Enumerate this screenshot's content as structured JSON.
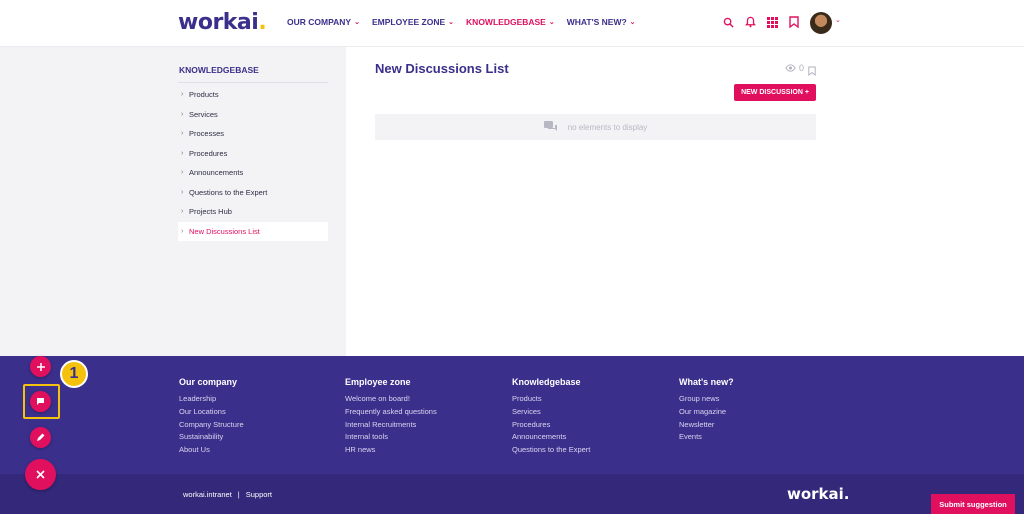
{
  "header": {
    "logo": "workai",
    "logo_dot": ".",
    "nav": [
      {
        "label": "OUR COMPANY",
        "active": false
      },
      {
        "label": "EMPLOYEE ZONE",
        "active": false
      },
      {
        "label": "KNOWLEDGEBASE",
        "active": true
      },
      {
        "label": "WHAT'S NEW?",
        "active": false
      }
    ],
    "icons": [
      "search-icon",
      "bell-icon",
      "apps-grid-icon",
      "bookmark-icon"
    ]
  },
  "sidebar": {
    "title": "KNOWLEDGEBASE",
    "items": [
      {
        "label": "Products"
      },
      {
        "label": "Services"
      },
      {
        "label": "Processes"
      },
      {
        "label": "Procedures"
      },
      {
        "label": "Announcements"
      },
      {
        "label": "Questions to the Expert"
      },
      {
        "label": "Projects Hub"
      },
      {
        "label": "New Discussions List"
      }
    ],
    "active_index": 7
  },
  "main": {
    "title": "New Discussions List",
    "views_count": "0",
    "new_button": "NEW DISCUSSION +",
    "empty_text": "no elements to display"
  },
  "footer": {
    "columns": [
      {
        "heading": "Our company",
        "links": [
          "Leadership",
          "Our Locations",
          "Company Structure",
          "Sustainability",
          "About Us"
        ]
      },
      {
        "heading": "Employee zone",
        "links": [
          "Welcome on board!",
          "Frequently asked questions",
          "Internal Recruitments",
          "Internal tools",
          "HR news"
        ]
      },
      {
        "heading": "Knowledgebase",
        "links": [
          "Products",
          "Services",
          "Procedures",
          "Announcements",
          "Questions to the Expert"
        ]
      },
      {
        "heading": "What's new?",
        "links": [
          "Group news",
          "Our magazine",
          "Newsletter",
          "Events"
        ]
      }
    ],
    "brand_text": "workai.intranet",
    "separator": "|",
    "support": "Support",
    "logo": "workai.",
    "suggest_button": "Submit suggestion"
  },
  "annotation": {
    "badge_number": "1"
  },
  "colors": {
    "brand": "#3b2f8c",
    "accent": "#e0105f",
    "highlight": "#f4c20d"
  }
}
